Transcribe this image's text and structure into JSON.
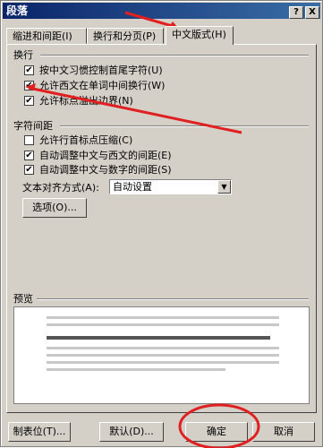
{
  "dialog": {
    "title": "段落",
    "help_btn": "?",
    "close_btn": "X"
  },
  "tabs": [
    {
      "label": "缩进和间距(I)"
    },
    {
      "label": "换行和分页(P)"
    },
    {
      "label": "中文版式(H)"
    }
  ],
  "section_wrap": {
    "title": "换行"
  },
  "wrap_options": [
    {
      "label": "按中文习惯控制首尾字符(U)",
      "checked": "✔"
    },
    {
      "label": "允许西文在单词中间换行(W)",
      "checked": "✔"
    },
    {
      "label": "允许标点溢出边界(N)",
      "checked": "✔"
    }
  ],
  "section_spacing": {
    "title": "字符间距"
  },
  "spacing_options": [
    {
      "label": "允许行首标点压缩(C)",
      "checked": ""
    },
    {
      "label": "自动调整中文与西文的间距(E)",
      "checked": "✔"
    },
    {
      "label": "自动调整中文与数字的间距(S)",
      "checked": "✔"
    }
  ],
  "alignment": {
    "label": "文本对齐方式(A):",
    "value": "自动设置"
  },
  "options_button": "选项(O)...",
  "preview": {
    "title": "预览"
  },
  "footer": {
    "tabs_btn": "制表位(T)...",
    "default_btn": "默认(D)...",
    "ok_btn": "确定",
    "cancel_btn": "取消"
  }
}
